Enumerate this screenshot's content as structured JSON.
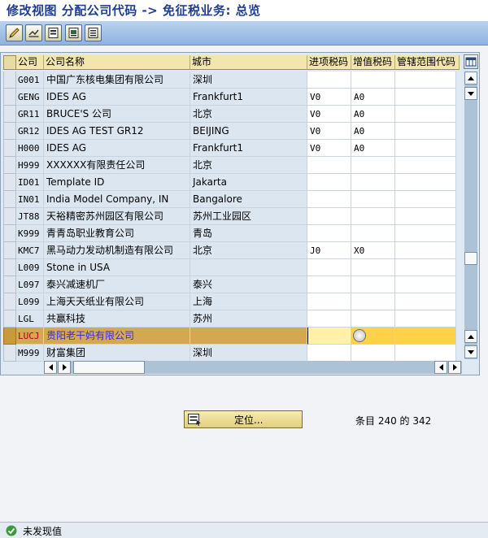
{
  "window": {
    "title": "修改视图 分配公司代码 -> 免征税业务: 总览"
  },
  "toolbar": {
    "buttons": [
      {
        "icon": "edit-pencil-icon"
      },
      {
        "icon": "display-change-icon"
      },
      {
        "icon": "select-all-icon"
      },
      {
        "icon": "select-block-icon"
      },
      {
        "icon": "deselect-all-icon"
      }
    ]
  },
  "table": {
    "headers": {
      "code": "公司",
      "name": "公司名称",
      "city": "城市",
      "input_tax": "进项税码",
      "vat_code": "增值税码",
      "range": "管辖范围代码"
    },
    "rows": [
      {
        "code": "G001",
        "name": "中国广东核电集团有限公司",
        "city": "深圳",
        "input_tax": "",
        "vat_code": "",
        "range": ""
      },
      {
        "code": "GENG",
        "name": "IDES AG",
        "city": "Frankfurt1",
        "input_tax": "V0",
        "vat_code": "A0",
        "range": ""
      },
      {
        "code": "GR11",
        "name": "BRUCE'S 公司",
        "city": "北京",
        "input_tax": "V0",
        "vat_code": "A0",
        "range": ""
      },
      {
        "code": "GR12",
        "name": "IDES AG TEST GR12",
        "city": "BEIJING",
        "input_tax": "V0",
        "vat_code": "A0",
        "range": ""
      },
      {
        "code": "H000",
        "name": "IDES AG",
        "city": "Frankfurt1",
        "input_tax": "V0",
        "vat_code": "A0",
        "range": ""
      },
      {
        "code": "H999",
        "name": "XXXXXX有限责任公司",
        "city": "北京",
        "input_tax": "",
        "vat_code": "",
        "range": ""
      },
      {
        "code": "ID01",
        "name": "Template ID",
        "city": "Jakarta",
        "input_tax": "",
        "vat_code": "",
        "range": ""
      },
      {
        "code": "IN01",
        "name": "India Model Company, IN",
        "city": "Bangalore",
        "input_tax": "",
        "vat_code": "",
        "range": ""
      },
      {
        "code": "JT88",
        "name": "天裕精密苏州园区有限公司",
        "city": "苏州工业园区",
        "input_tax": "",
        "vat_code": "",
        "range": ""
      },
      {
        "code": "K999",
        "name": "青青岛职业教育公司",
        "city": "青岛",
        "input_tax": "",
        "vat_code": "",
        "range": ""
      },
      {
        "code": "KMC7",
        "name": "黑马动力发动机制造有限公司",
        "city": "北京",
        "input_tax": "J0",
        "vat_code": "X0",
        "range": ""
      },
      {
        "code": "L009",
        "name": "Stone in USA",
        "city": "",
        "input_tax": "",
        "vat_code": "",
        "range": ""
      },
      {
        "code": "L097",
        "name": "泰兴减速机厂",
        "city": "泰兴",
        "input_tax": "",
        "vat_code": "",
        "range": ""
      },
      {
        "code": "L099",
        "name": "上海天天纸业有限公司",
        "city": "上海",
        "input_tax": "",
        "vat_code": "",
        "range": ""
      },
      {
        "code": "LGL",
        "name": "共赢科技",
        "city": "苏州",
        "input_tax": "",
        "vat_code": "",
        "range": ""
      },
      {
        "code": "LUCJ",
        "name": "贵阳老干妈有限公司",
        "city": "",
        "input_tax": "",
        "vat_code": "",
        "range": "",
        "selected": true
      },
      {
        "code": "M999",
        "name": "财富集团",
        "city": "深圳",
        "input_tax": "",
        "vat_code": "",
        "range": ""
      }
    ]
  },
  "footer": {
    "position_button": "定位...",
    "entry_count": "条目 240 的 342"
  },
  "status": {
    "message": "未发现值"
  }
}
